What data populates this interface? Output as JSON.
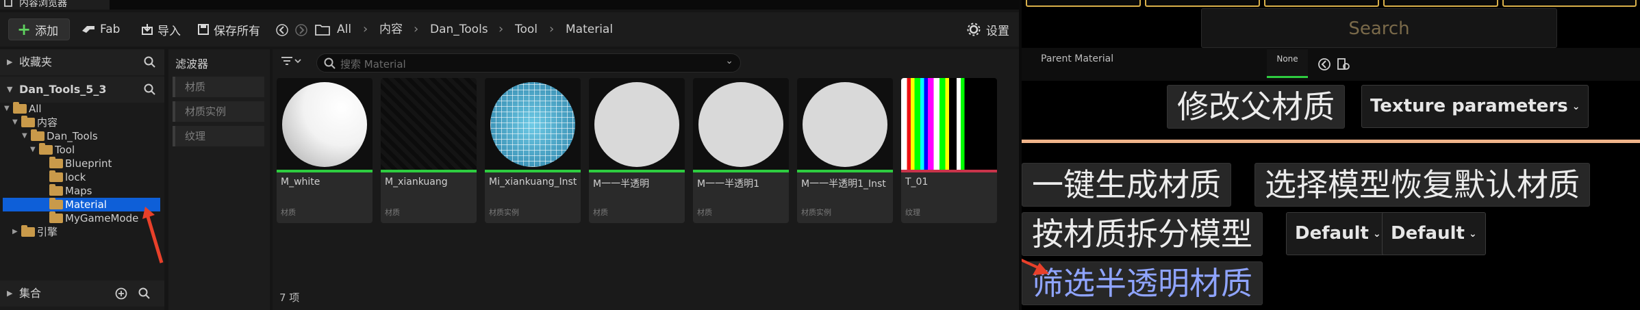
{
  "content_browser": {
    "window_tab": "内容浏览器",
    "toolbar": {
      "add": "添加",
      "fab": "Fab",
      "import": "导入",
      "save_all": "保存所有",
      "settings": "设置"
    },
    "breadcrumb": [
      "All",
      "内容",
      "Dan_Tools",
      "Tool",
      "Material"
    ],
    "sources": {
      "favorites": "收藏夹",
      "project": "Dan_Tools_5_3",
      "collections": "集合"
    },
    "tree": [
      {
        "label": "All",
        "depth": 0,
        "expanded": true
      },
      {
        "label": "内容",
        "depth": 1,
        "expanded": true
      },
      {
        "label": "Dan_Tools",
        "depth": 2,
        "expanded": true
      },
      {
        "label": "Tool",
        "depth": 3,
        "expanded": true
      },
      {
        "label": "Blueprint",
        "depth": 4
      },
      {
        "label": "lock",
        "depth": 4
      },
      {
        "label": "Maps",
        "depth": 4
      },
      {
        "label": "Material",
        "depth": 4,
        "selected": true
      },
      {
        "label": "MyGameMode",
        "depth": 4
      },
      {
        "label": "引擎",
        "depth": 1,
        "expanded": false
      }
    ],
    "filter_panel": {
      "title": "滤波器",
      "items": [
        "材质",
        "材质实例",
        "纹理"
      ]
    },
    "search_placeholder": "搜索 Material",
    "assets": [
      {
        "name": "M_white",
        "type": "材质",
        "thumb": "white-sphere"
      },
      {
        "name": "M_xiankuang",
        "type": "材质",
        "thumb": "dark"
      },
      {
        "name": "Mi_xiankuang_Inst",
        "type": "材质实例",
        "thumb": "wire-sphere"
      },
      {
        "name": "M一一半透明",
        "type": "材质",
        "thumb": "gray-sphere"
      },
      {
        "name": "M一一半透明1",
        "type": "材质",
        "thumb": "gray-sphere"
      },
      {
        "name": "M一一半透明1_Inst",
        "type": "材质实例",
        "thumb": "gray-sphere"
      },
      {
        "name": "T_01",
        "type": "纹理",
        "thumb": "stripes"
      }
    ],
    "item_count": "7 项"
  },
  "tool_panel": {
    "search_placeholder": "Search",
    "parent_material_label": "Parent Material",
    "parent_material_value": "None",
    "modify_parent": "修改父材质",
    "texture_params": "Texture parameters",
    "one_click_gen": "一键生成材质",
    "restore_default": "选择模型恢复默认材质",
    "split_by_material": "按材质拆分模型",
    "default_1": "Default",
    "default_2": "Default",
    "filter_translucent": "筛选半透明材质"
  },
  "colors": {
    "accent_green": "#2ecc40",
    "selection_blue": "#0e5fd8",
    "texture_red": "#c8344a",
    "divider_peach": "#f0b48a",
    "highlight_text": "#8fa4ff",
    "annotation_red": "#e8402a"
  }
}
